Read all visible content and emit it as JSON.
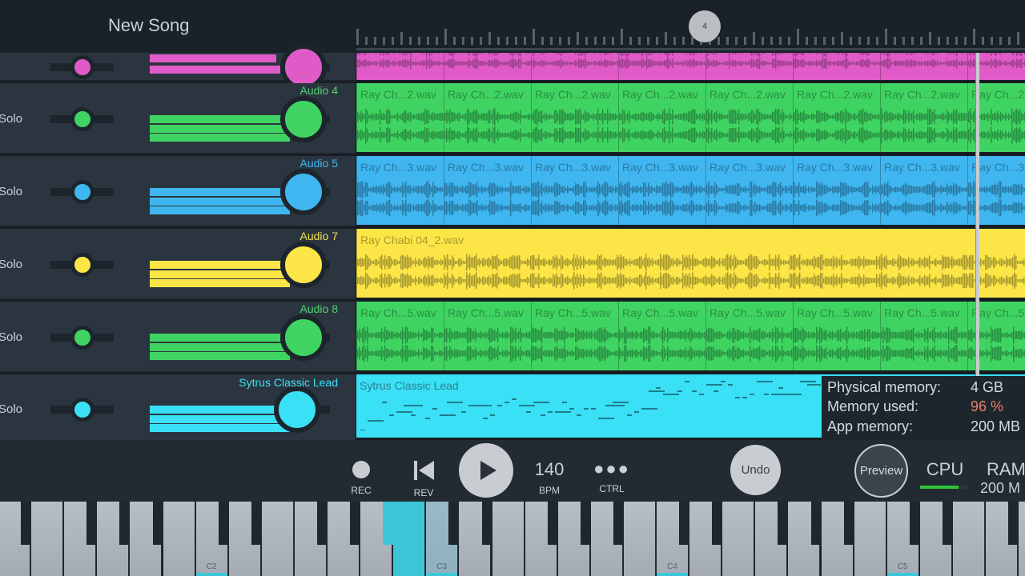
{
  "title": "New Song",
  "marker": "4",
  "tracks": [
    {
      "name": "",
      "color": "#e05bc8",
      "dark": "#9c3f8c",
      "clip": ""
    },
    {
      "name": "Audio 4",
      "color": "#3fd461",
      "dark": "#2a8f42",
      "namecolor": "#4fd470",
      "clip": "Ray Ch...2.wav",
      "solo": "Solo"
    },
    {
      "name": "Audio 5",
      "color": "#3fb6f0",
      "dark": "#2a7aa3",
      "namecolor": "#3fb6f0",
      "clip": "Ray Ch...3.wav",
      "solo": "Solo"
    },
    {
      "name": "Audio 7",
      "color": "#fce546",
      "dark": "#a89a30",
      "namecolor": "#f5e04a",
      "clip": "Ray Chabi 04_2.wav",
      "solo": "Solo"
    },
    {
      "name": "Audio 8",
      "color": "#3fd461",
      "dark": "#2a8f42",
      "namecolor": "#4fd470",
      "clip": "Ray Ch...5.wav",
      "solo": "Solo"
    },
    {
      "name": "Sytrus Classic Lead",
      "color": "#3ae0f5",
      "dark": "#2a8a99",
      "namecolor": "#3ae0f5",
      "clip": "Sytrus Classic Lead",
      "solo": "Solo"
    }
  ],
  "memory": {
    "physical_label": "Physical memory:",
    "physical": "4 GB",
    "used_label": "Memory used:",
    "used": "96 %",
    "used_color": "#e8806a",
    "app_label": "App memory:",
    "app": "200 MB"
  },
  "transport": {
    "rec": "REC",
    "rev": "REV",
    "bpm": "140",
    "bpm_label": "BPM",
    "ctrl": "CTRL",
    "undo": "Undo",
    "preview": "Preview",
    "cpu": "CPU",
    "ram": "RAM",
    "ram_value": "200 M"
  },
  "piano": {
    "labels": [
      "C2",
      "C3",
      "C4",
      "C5"
    ],
    "highlight_color": "#3cc7d8"
  }
}
